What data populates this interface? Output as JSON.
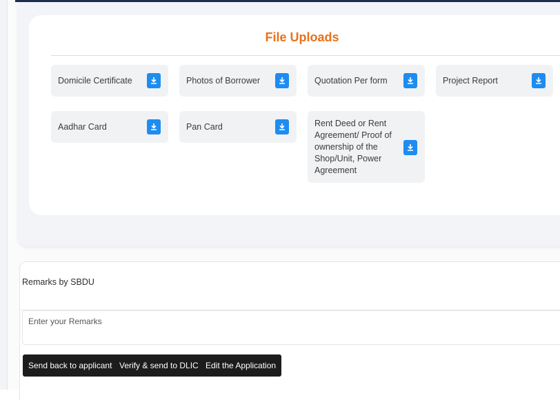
{
  "uploads": {
    "title": "File Uploads",
    "files": [
      {
        "label": "Domicile Certificate"
      },
      {
        "label": "Photos of Borrower"
      },
      {
        "label": "Quotation Per form"
      },
      {
        "label": "Project Report"
      },
      {
        "label": "Aadhar Card"
      },
      {
        "label": "Pan Card"
      },
      {
        "label": "Rent Deed or Rent Agreement/ Proof of ownership of the Shop/Unit, Power Agreement"
      }
    ],
    "download_icon": "download-icon",
    "accent_color": "#e8711b",
    "button_color": "#1e8cf0"
  },
  "remarks": {
    "label": "Remarks by SBDU",
    "placeholder": "Enter your Remarks",
    "value": ""
  },
  "actions": {
    "send_back": "Send back to applicant",
    "verify_send": "Verify & send to DLIC",
    "edit": "Edit the Application"
  }
}
